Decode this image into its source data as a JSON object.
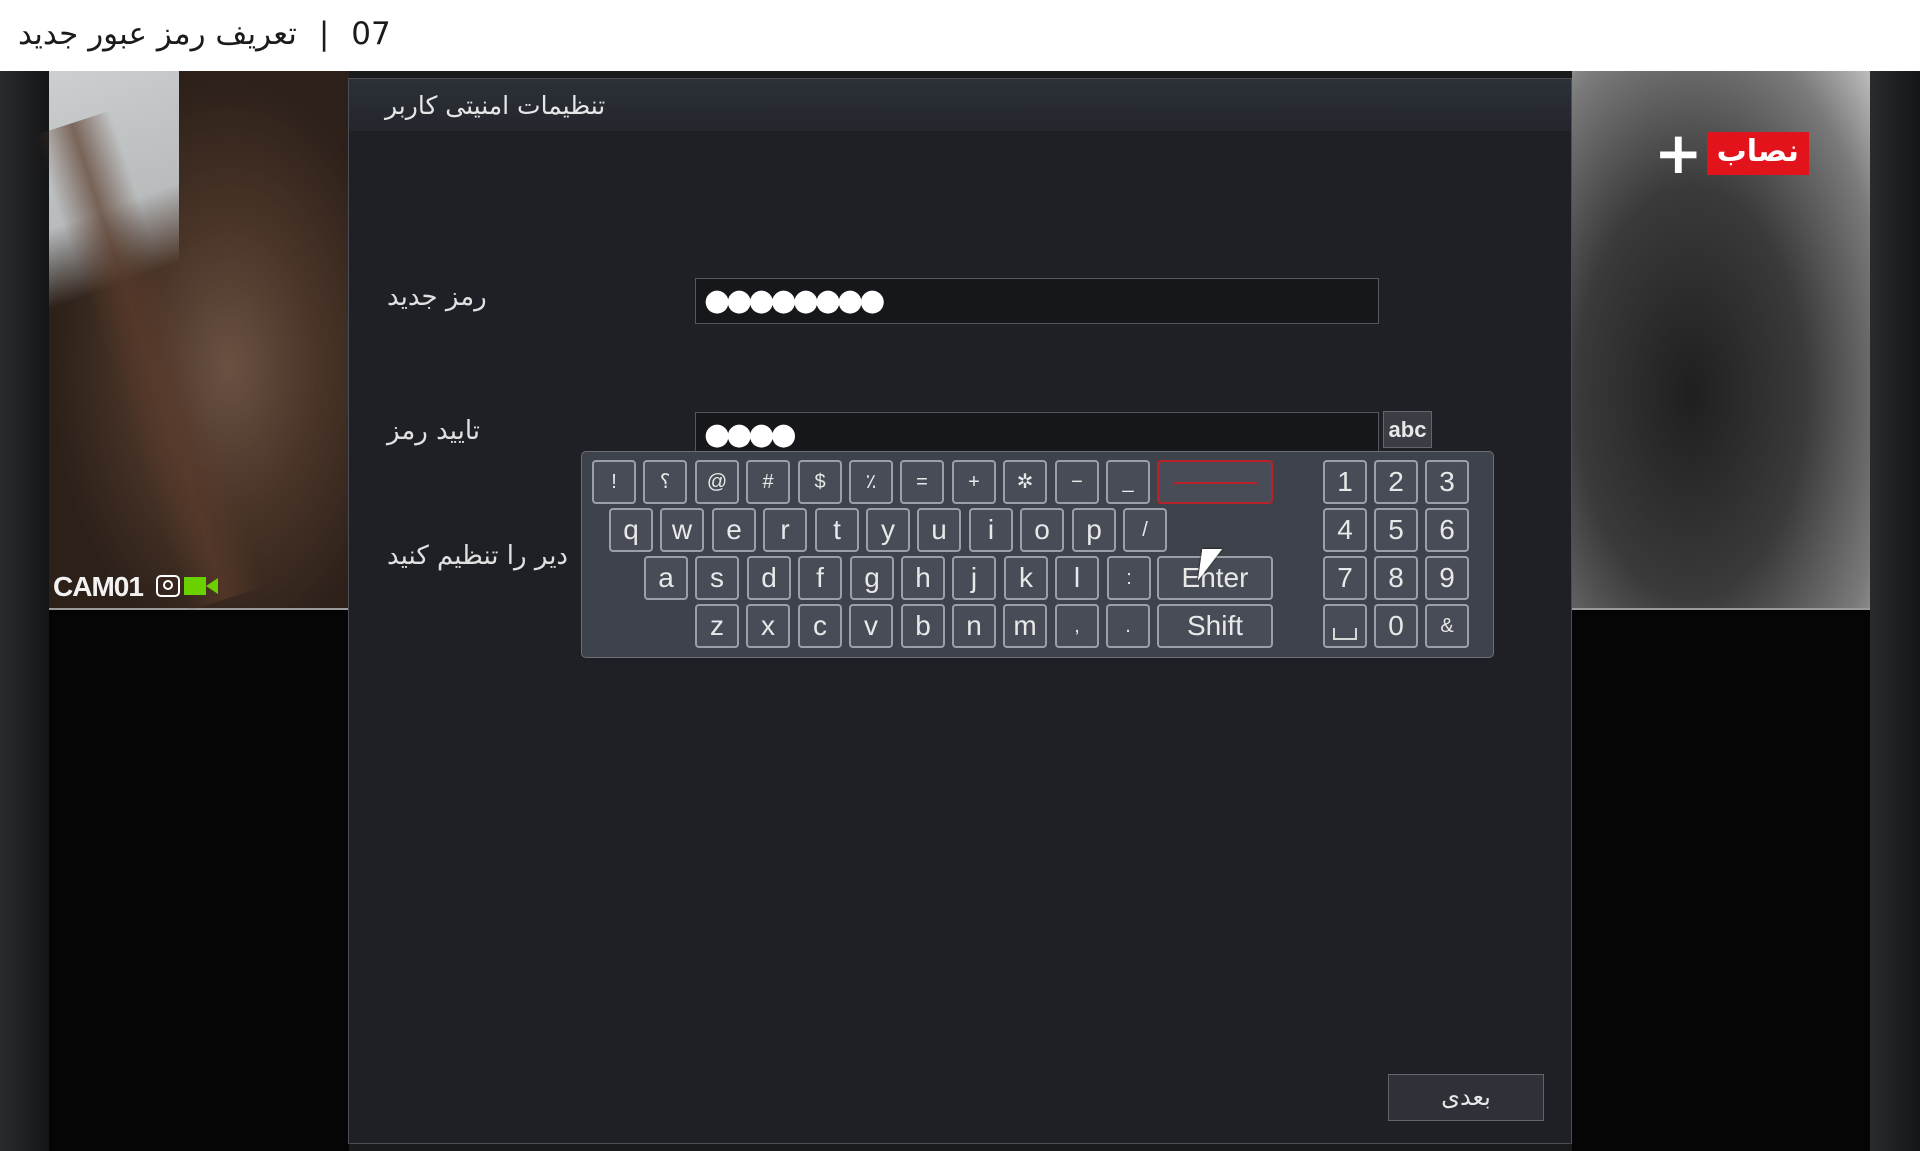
{
  "caption": {
    "number": "07",
    "separator": "|",
    "title": "تعریف رمز عبور جدید"
  },
  "camera": {
    "label": "CAM01",
    "icons": [
      "record-icon",
      "video-camera-icon"
    ]
  },
  "logo": {
    "text": "نصاب",
    "plus": "+"
  },
  "dialog": {
    "title": "تنظیمات امنیتی کاربر",
    "new_password_label": "رمز جدید",
    "new_password_value": "●●●●●●●●",
    "confirm_password_label": "تایید رمز",
    "confirm_password_value": "●●●●",
    "partial_label": "دیر را تنظیم کنید",
    "input_mode_button": "abc",
    "next_button": "بعدی"
  },
  "keyboard": {
    "row1": [
      "!",
      "؟",
      "@",
      "#",
      "$",
      "٪",
      "=",
      "+",
      "✲",
      "−",
      "_"
    ],
    "row2": [
      "q",
      "w",
      "e",
      "r",
      "t",
      "y",
      "u",
      "i",
      "o",
      "p",
      "/"
    ],
    "row3": [
      "a",
      "s",
      "d",
      "f",
      "g",
      "h",
      "j",
      "k",
      "l",
      ":"
    ],
    "row4": [
      "z",
      "x",
      "c",
      "v",
      "b",
      "n",
      "m",
      ",",
      "."
    ],
    "enter": "Enter",
    "shift": "Shift",
    "numpad": [
      "1",
      "2",
      "3",
      "4",
      "5",
      "6",
      "7",
      "8",
      "9",
      "",
      "0",
      "&"
    ]
  },
  "colors": {
    "dialog_bg": "#1e2025",
    "key_highlight": "#b8232b",
    "logo_red": "#e3131b",
    "rec_green": "#6ad000"
  }
}
